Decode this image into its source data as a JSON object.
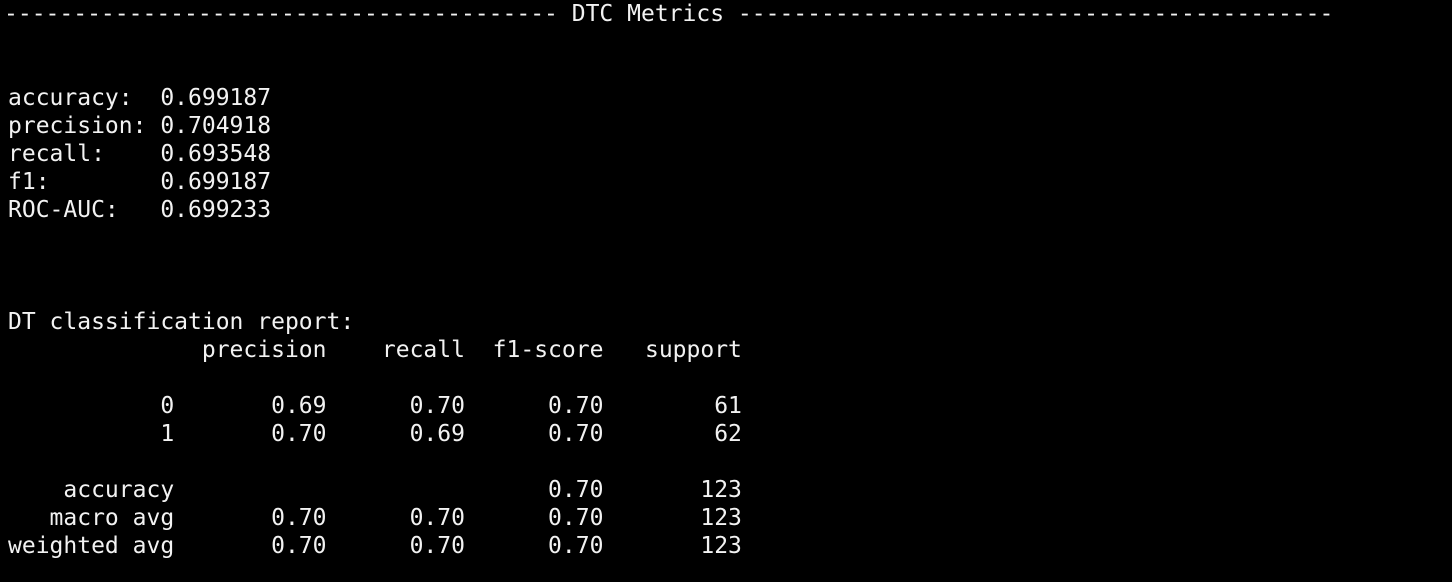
{
  "terminal": {
    "header": "---------------------------------------- DTC Metrics -------------------------------------------",
    "metrics": [
      "accuracy:  0.699187",
      "precision: 0.704918",
      "recall:    0.693548",
      "f1:        0.699187",
      "ROC-AUC:   0.699233"
    ],
    "report": {
      "title": "DT classification report:",
      "header_row": "              precision    recall  f1-score   support",
      "rows": [
        "           0       0.69      0.70      0.70        61",
        "           1       0.70      0.69      0.70        62",
        "    accuracy                           0.70       123",
        "   macro avg       0.70      0.70      0.70       123",
        "weighted avg       0.70      0.70      0.70       123"
      ]
    }
  }
}
